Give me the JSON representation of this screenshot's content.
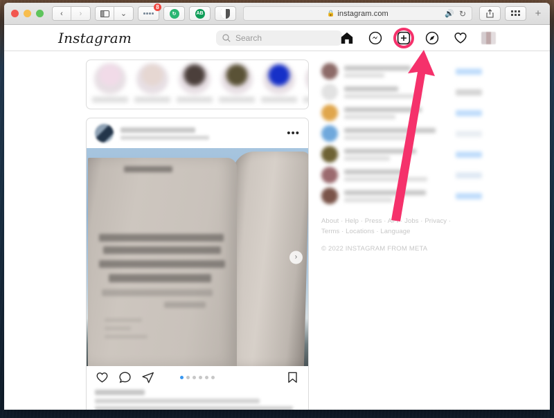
{
  "browser": {
    "url": "instagram.com",
    "lock_icon": "lock-icon",
    "back_label": "‹",
    "forward_label": "›",
    "sidebar_icon": "sidebar-icon",
    "tab_overview_label": "⌄",
    "extension_badge": "8",
    "extension_1": "password-manager-icon",
    "extension_2": "green-refresh-icon",
    "extension_3": "adblock-icon",
    "extension_4": "contrast-shield-icon",
    "speaker_icon": "speaker-playing-icon",
    "reload_icon": "reload-icon",
    "share_icon": "share-icon",
    "tabs_icon": "tab-grid-icon",
    "new_tab_label": "+"
  },
  "header": {
    "logo": "Instagram",
    "nav": [
      {
        "name": "home-icon",
        "label": "Home"
      },
      {
        "name": "messenger-icon",
        "label": "Messages"
      },
      {
        "name": "create-icon",
        "label": "Create"
      },
      {
        "name": "compass-icon",
        "label": "Explore"
      },
      {
        "name": "heart-icon",
        "label": "Activity"
      },
      {
        "name": "avatar",
        "label": "Profile"
      }
    ]
  },
  "search": {
    "placeholder": "Search",
    "value": "",
    "icon": "search-icon"
  },
  "highlight": {
    "color": "#f5316b",
    "target": "create-icon",
    "annotation": "arrow-pointing-to-create-button"
  },
  "stories": {
    "count": 6,
    "items": [
      {
        "name": "story-1",
        "ring": "#f1dbe8"
      },
      {
        "name": "story-2",
        "ring": "#e6d7d2"
      },
      {
        "name": "story-3",
        "ring": "#4b3f3b"
      },
      {
        "name": "story-4",
        "ring": "#5a5236"
      },
      {
        "name": "story-5",
        "ring": "#1630c8"
      },
      {
        "name": "story-6",
        "ring": "#d9cfd4"
      }
    ]
  },
  "post": {
    "username_redacted": true,
    "location_redacted": true,
    "more_label": "•••",
    "image_alt": "open book held against blue sky",
    "carousel": {
      "total": 6,
      "active_index": 0,
      "next_label": "›"
    },
    "actions": [
      {
        "name": "like-icon",
        "label": "Like"
      },
      {
        "name": "comment-icon",
        "label": "Comment"
      },
      {
        "name": "share-post-icon",
        "label": "Share"
      },
      {
        "name": "bookmark-icon",
        "label": "Save"
      }
    ]
  },
  "sidebar": {
    "suggestions": [
      {
        "avatar": "#8d6b68",
        "action": "#bfdcfb",
        "name_w": 96,
        "sub_w": 58
      },
      {
        "avatar": "#e2e2e2",
        "action": "#d4d4d4",
        "name_w": 78,
        "sub_w": 112
      },
      {
        "avatar": "#e0a64c",
        "action": "#bfdcfb",
        "name_w": 112,
        "sub_w": 74
      },
      {
        "avatar": "#6fa8dc",
        "action": "#e9eef3",
        "name_w": 132,
        "sub_w": 92
      },
      {
        "avatar": "#6e6234",
        "action": "#bfdcfb",
        "name_w": 104,
        "sub_w": 66
      },
      {
        "avatar": "#9b6a6e",
        "action": "#dfe9f4",
        "name_w": 86,
        "sub_w": 120
      },
      {
        "avatar": "#7a5449",
        "action": "#bfdcfb",
        "name_w": 118,
        "sub_w": 70
      }
    ],
    "footer_links": "About · Help · Press · API · Jobs · Privacy · Terms · Locations · Language",
    "copyright": "© 2022 INSTAGRAM FROM META"
  }
}
